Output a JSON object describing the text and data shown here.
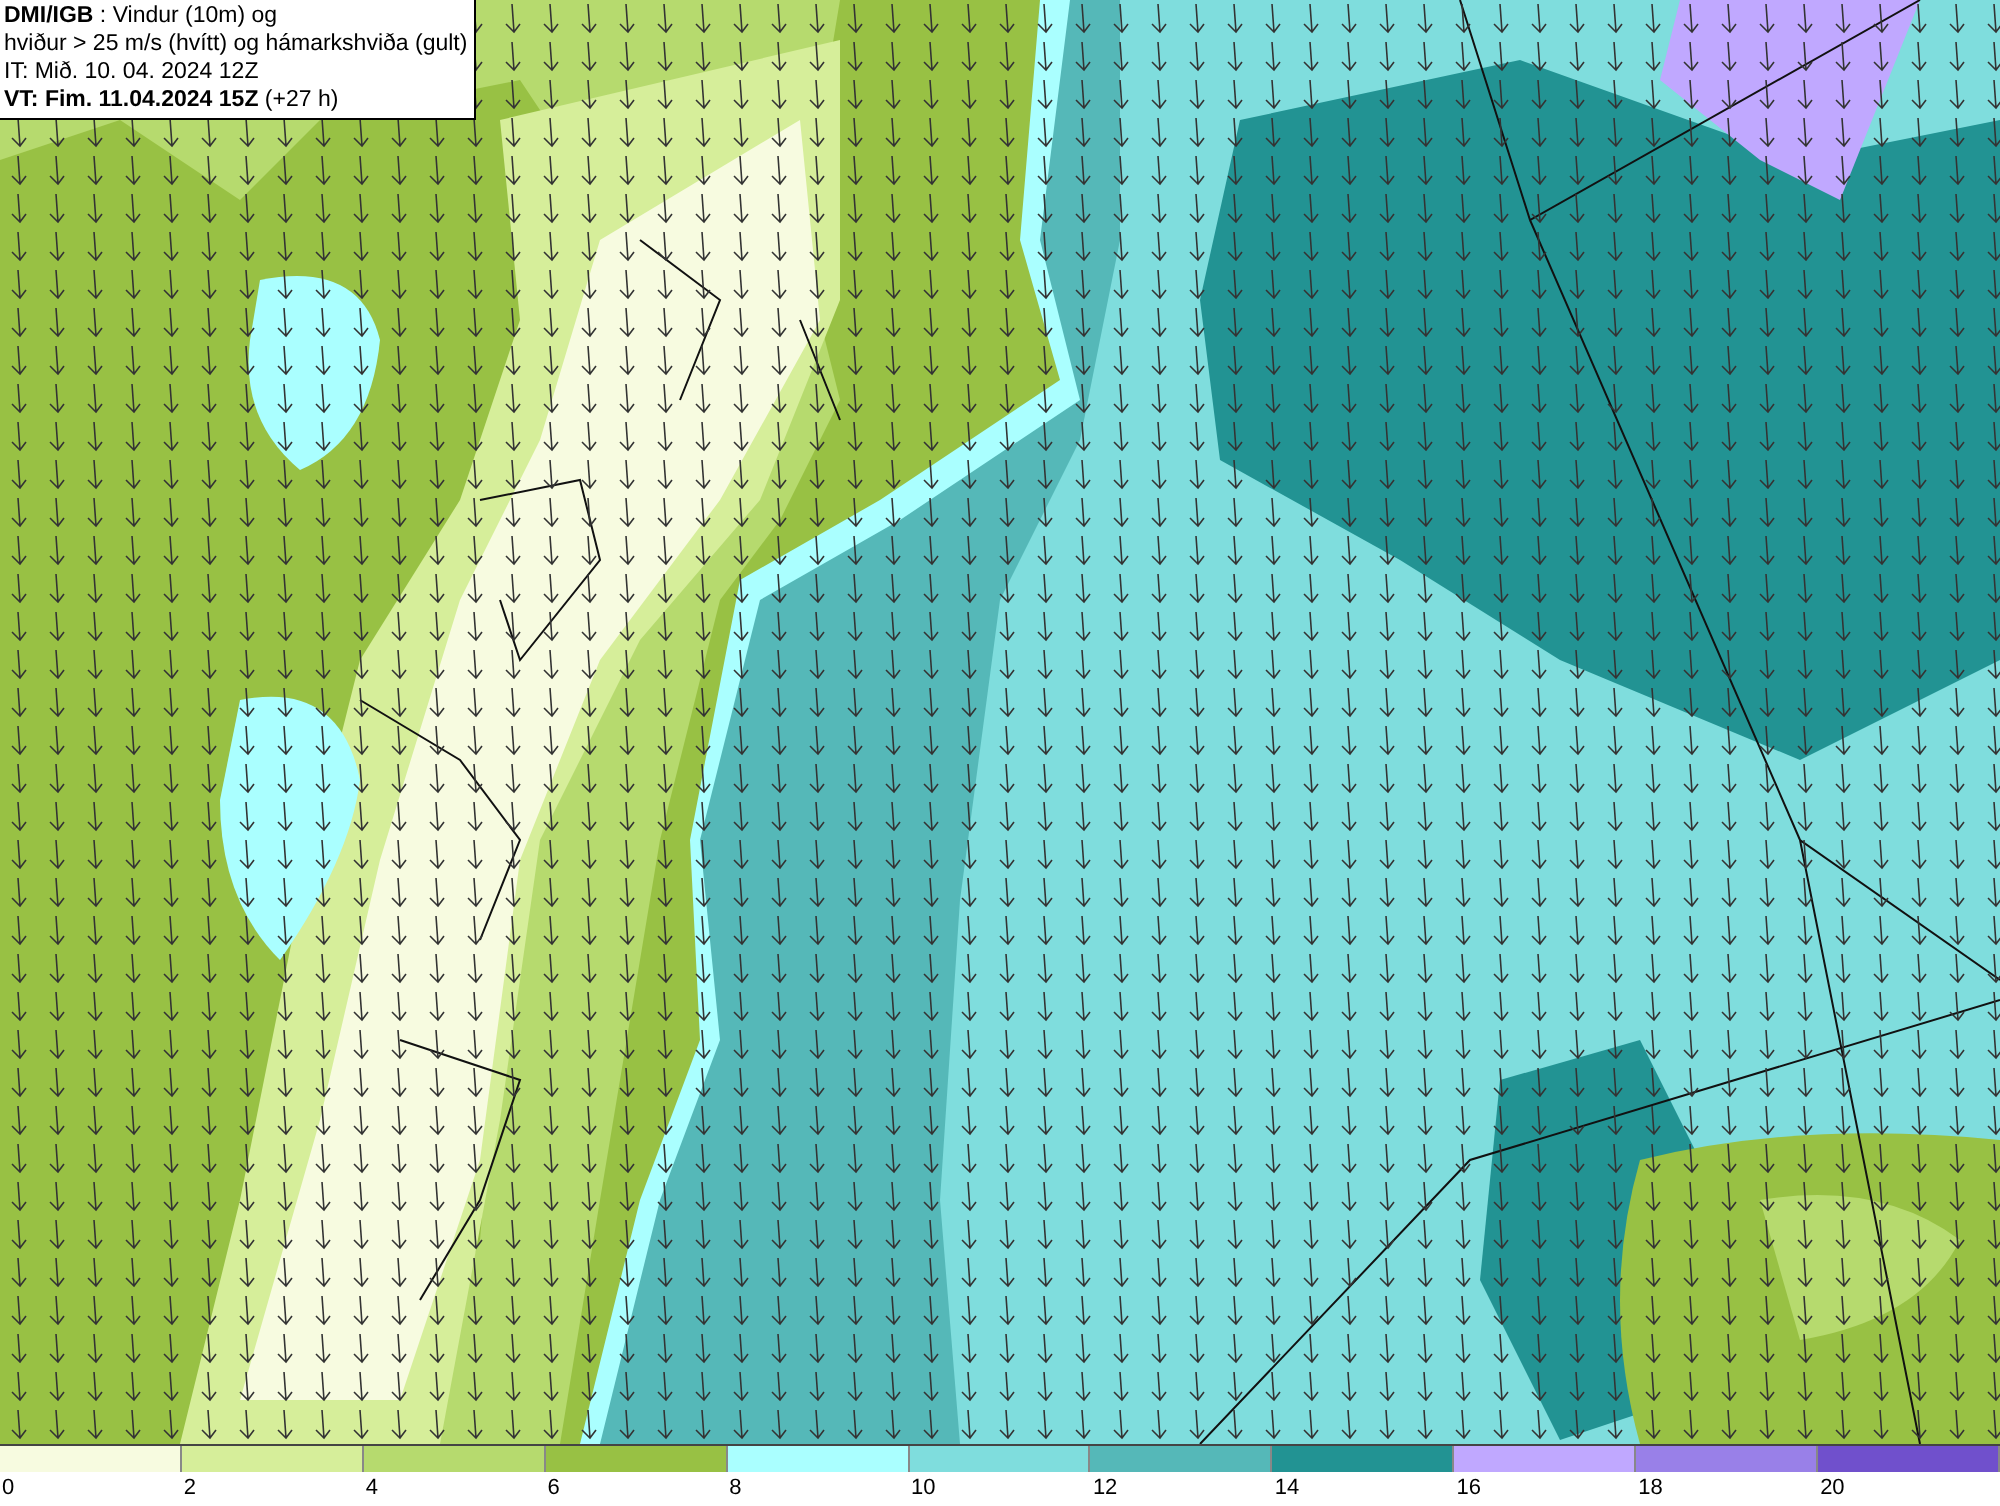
{
  "info_box": {
    "lines": [
      "**DMI/IGB** : Vindur (10m) og",
      "hviður > 25 m/s (hvítt) og hámarkshviða (gult)",
      "IT: Mið. 10. 04. 2024 12Z",
      "**VT: Fim. 11.04.2024 15Z** (+27 h)"
    ]
  },
  "legend": [
    {
      "label": "0",
      "color": "#f7fbe0"
    },
    {
      "label": "2",
      "color": "#d6ee9a"
    },
    {
      "label": "4",
      "color": "#b6da6e"
    },
    {
      "label": "6",
      "color": "#98c144"
    },
    {
      "label": "8",
      "color": "#aaffff"
    },
    {
      "label": "10",
      "color": "#7fdddd"
    },
    {
      "label": "12",
      "color": "#55b8b8"
    },
    {
      "label": "14",
      "color": "#229393"
    },
    {
      "label": "16",
      "color": "#c0a8ff"
    },
    {
      "label": "18",
      "color": "#9980e8"
    },
    {
      "label": "20",
      "color": "#7050cc"
    }
  ]
}
